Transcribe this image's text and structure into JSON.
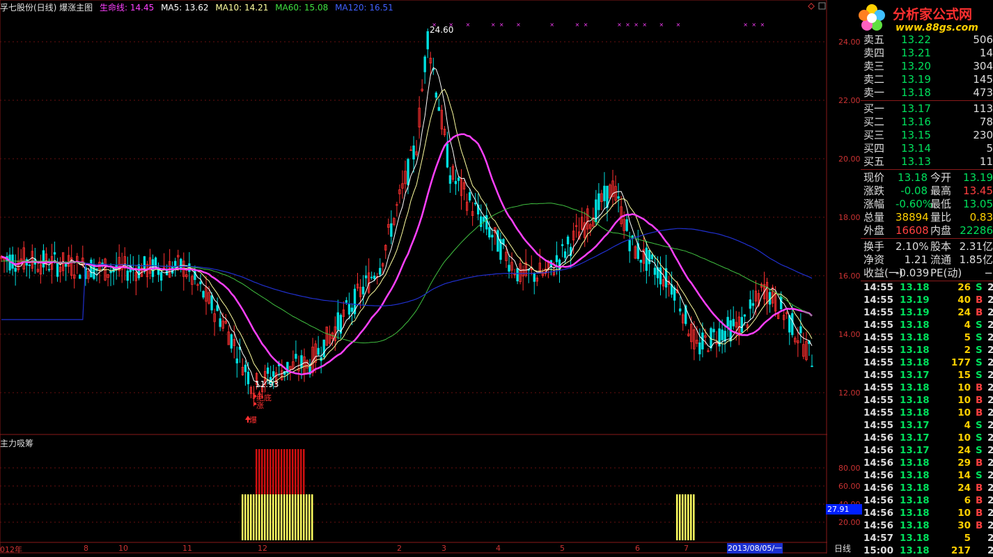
{
  "header": {
    "name": "孚七股份(日线) 爆涨主图",
    "lifeline": "生命线: 14.45",
    "ma5": "MA5: 13.62",
    "ma10": "MA10: 14.21",
    "ma60": "MA60: 15.08",
    "ma120": "MA120: 16.51",
    "colors": {
      "name": "#e0e0e0",
      "lifeline": "#ff40ff",
      "ma5": "#ffffff",
      "ma10": "#ffffa0",
      "ma60": "#40e040",
      "ma120": "#4040ff"
    }
  },
  "price_axis": [
    "24.00",
    "22.00",
    "20.00",
    "18.00",
    "16.00",
    "14.00",
    "12.00"
  ],
  "sub_axis": [
    "80.00",
    "60.00",
    "40.00",
    "20.00"
  ],
  "annotations": {
    "high": "24.60",
    "low": "11.93",
    "bottom1": "绝底",
    "bottom2": "涨",
    "burst": "爆"
  },
  "sub_chart": {
    "title": "主力吸筹",
    "current_value": "27.91"
  },
  "x_labels": [
    "012年",
    "8",
    "10",
    "11",
    "12",
    "2",
    "3",
    "4",
    "5",
    "6",
    "7"
  ],
  "date_box": "2013/08/05/一",
  "period": "日线",
  "logo": {
    "title": "分析家公式网",
    "url": "www.88gs.com"
  },
  "order_book": {
    "asks": [
      {
        "label": "卖五",
        "price": "13.22",
        "vol": "506"
      },
      {
        "label": "卖四",
        "price": "13.21",
        "vol": "14"
      },
      {
        "label": "卖三",
        "price": "13.20",
        "vol": "304"
      },
      {
        "label": "卖二",
        "price": "13.19",
        "vol": "145"
      },
      {
        "label": "卖一",
        "price": "13.18",
        "vol": "473"
      }
    ],
    "bids": [
      {
        "label": "买一",
        "price": "13.17",
        "vol": "113"
      },
      {
        "label": "买二",
        "price": "13.16",
        "vol": "78"
      },
      {
        "label": "买三",
        "price": "13.15",
        "vol": "230"
      },
      {
        "label": "买四",
        "price": "13.14",
        "vol": "5"
      },
      {
        "label": "买五",
        "price": "13.13",
        "vol": "11"
      }
    ]
  },
  "quote": [
    {
      "l1": "现价",
      "v1": "13.18",
      "c1": "#00e05c",
      "l2": "今开",
      "v2": "13.19",
      "c2": "#00e05c"
    },
    {
      "l1": "涨跌",
      "v1": "-0.08",
      "c1": "#00e05c",
      "l2": "最高",
      "v2": "13.45",
      "c2": "#ff4040"
    },
    {
      "l1": "涨幅",
      "v1": "-0.60%",
      "c1": "#00e05c",
      "l2": "最低",
      "v2": "13.05",
      "c2": "#00e05c"
    },
    {
      "l1": "总量",
      "v1": "38894",
      "c1": "#ffd000",
      "l2": "量比",
      "v2": "0.83",
      "c2": "#ffd000"
    },
    {
      "l1": "外盘",
      "v1": "16608",
      "c1": "#ff4040",
      "l2": "内盘",
      "v2": "22286",
      "c2": "#00e05c"
    }
  ],
  "fundamentals": [
    {
      "l1": "换手",
      "v1": "2.10%",
      "l2": "股本",
      "v2": "2.31亿"
    },
    {
      "l1": "净资",
      "v1": "1.21",
      "l2": "流通",
      "v2": "1.85亿"
    },
    {
      "l1": "收益(一)",
      "v1": "-0.039",
      "l2": "PE(动)",
      "v2": "−"
    }
  ],
  "ticks": [
    {
      "t": "14:55",
      "p": "13.18",
      "v": "26",
      "d": "S",
      "x": "2"
    },
    {
      "t": "14:55",
      "p": "13.19",
      "v": "40",
      "d": "B",
      "x": "2"
    },
    {
      "t": "14:55",
      "p": "13.19",
      "v": "24",
      "d": "B",
      "x": "2"
    },
    {
      "t": "14:55",
      "p": "13.18",
      "v": "4",
      "d": "S",
      "x": "2"
    },
    {
      "t": "14:55",
      "p": "13.18",
      "v": "5",
      "d": "S",
      "x": "2"
    },
    {
      "t": "14:55",
      "p": "13.18",
      "v": "2",
      "d": "S",
      "x": "2"
    },
    {
      "t": "14:55",
      "p": "13.18",
      "v": "177",
      "d": "S",
      "x": "2"
    },
    {
      "t": "14:55",
      "p": "13.17",
      "v": "15",
      "d": "S",
      "x": "2"
    },
    {
      "t": "14:55",
      "p": "13.18",
      "v": "10",
      "d": "B",
      "x": "2"
    },
    {
      "t": "14:55",
      "p": "13.18",
      "v": "10",
      "d": "B",
      "x": "2"
    },
    {
      "t": "14:55",
      "p": "13.18",
      "v": "10",
      "d": "B",
      "x": "2"
    },
    {
      "t": "14:55",
      "p": "13.17",
      "v": "4",
      "d": "S",
      "x": "2"
    },
    {
      "t": "14:56",
      "p": "13.17",
      "v": "10",
      "d": "S",
      "x": "2"
    },
    {
      "t": "14:56",
      "p": "13.17",
      "v": "24",
      "d": "S",
      "x": "2"
    },
    {
      "t": "14:56",
      "p": "13.18",
      "v": "29",
      "d": "B",
      "x": "2"
    },
    {
      "t": "14:56",
      "p": "13.18",
      "v": "14",
      "d": "S",
      "x": "2"
    },
    {
      "t": "14:56",
      "p": "13.18",
      "v": "24",
      "d": "B",
      "x": "2"
    },
    {
      "t": "14:56",
      "p": "13.18",
      "v": "6",
      "d": "B",
      "x": "2"
    },
    {
      "t": "14:56",
      "p": "13.18",
      "v": "10",
      "d": "B",
      "x": "2"
    },
    {
      "t": "14:56",
      "p": "13.18",
      "v": "30",
      "d": "B",
      "x": "2"
    },
    {
      "t": "14:57",
      "p": "13.18",
      "v": "5",
      "d": "",
      "x": "2"
    },
    {
      "t": "15:00",
      "p": "13.18",
      "v": "217",
      "d": "",
      "x": "2"
    }
  ]
}
